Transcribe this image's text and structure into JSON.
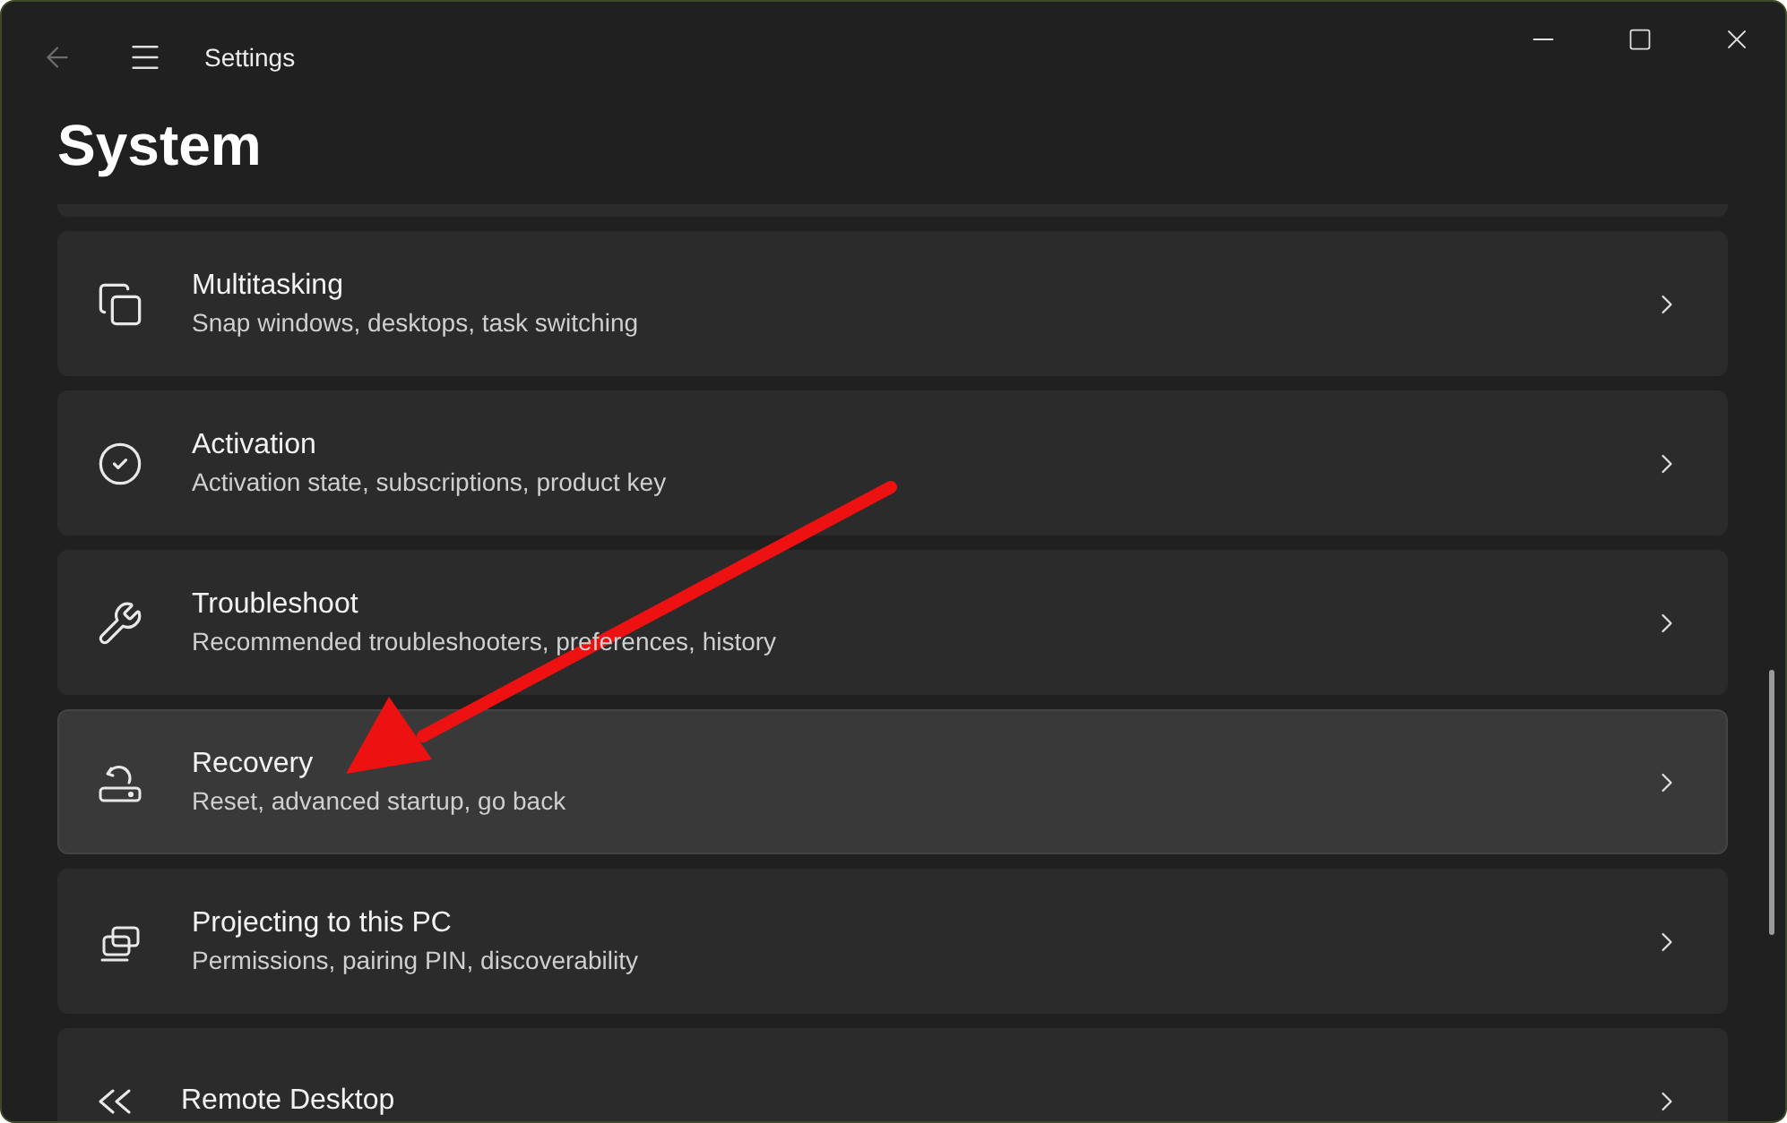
{
  "window": {
    "title": "Settings"
  },
  "page": {
    "title": "System"
  },
  "items": [
    {
      "kind": "multitasking",
      "title": "Multitasking",
      "subtitle": "Snap windows, desktops, task switching",
      "highlighted": false
    },
    {
      "kind": "activation",
      "title": "Activation",
      "subtitle": "Activation state, subscriptions, product key",
      "highlighted": false
    },
    {
      "kind": "troubleshoot",
      "title": "Troubleshoot",
      "subtitle": "Recommended troubleshooters, preferences, history",
      "highlighted": false
    },
    {
      "kind": "recovery",
      "title": "Recovery",
      "subtitle": "Reset, advanced startup, go back",
      "highlighted": true
    },
    {
      "kind": "projecting",
      "title": "Projecting to this PC",
      "subtitle": "Permissions, pairing PIN, discoverability",
      "highlighted": false
    },
    {
      "kind": "remote",
      "title": "Remote Desktop",
      "highlighted": false
    }
  ]
}
